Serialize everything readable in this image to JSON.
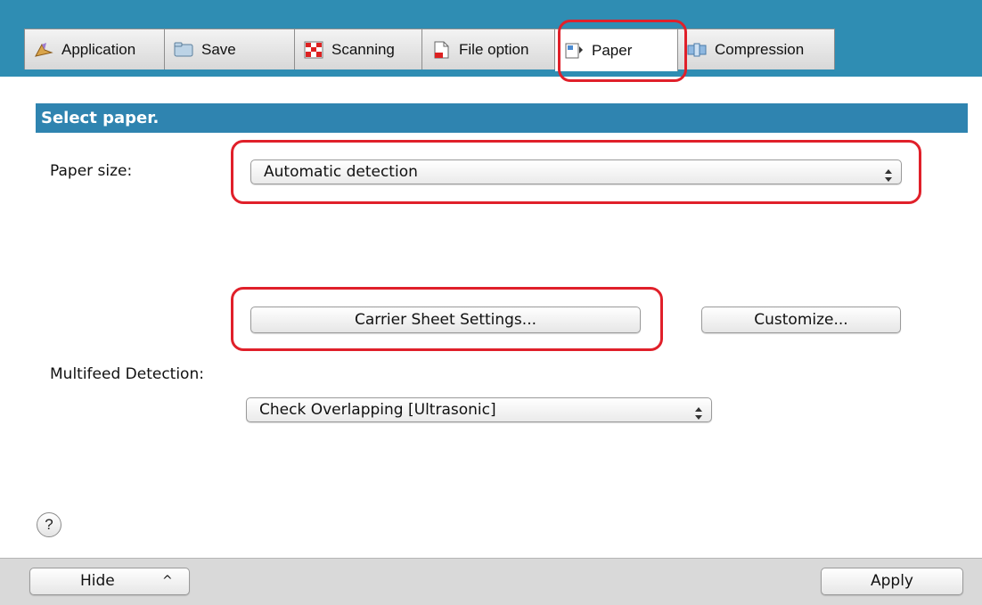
{
  "tabs": [
    {
      "label": "Application",
      "icon": "application-icon",
      "active": false
    },
    {
      "label": "Save",
      "icon": "folder-icon",
      "active": false
    },
    {
      "label": "Scanning",
      "icon": "scanning-icon",
      "active": false
    },
    {
      "label": "File option",
      "icon": "file-icon",
      "active": false
    },
    {
      "label": "Paper",
      "icon": "paper-icon",
      "active": true
    },
    {
      "label": "Compression",
      "icon": "compression-icon",
      "active": false
    }
  ],
  "section": {
    "title": "Select paper."
  },
  "paper_size": {
    "label": "Paper size:",
    "selected": "Automatic detection"
  },
  "buttons": {
    "carrier_sheet": "Carrier Sheet Settings...",
    "customize": "Customize..."
  },
  "multifeed": {
    "label": "Multifeed Detection:",
    "selected": "Check Overlapping [Ultrasonic]"
  },
  "help": {
    "symbol": "?"
  },
  "footer": {
    "hide": "Hide",
    "hide_caret": "^",
    "apply": "Apply"
  },
  "colors": {
    "accent": "#2f8db3",
    "highlight": "#e0202a",
    "header": "#2f84b0"
  }
}
